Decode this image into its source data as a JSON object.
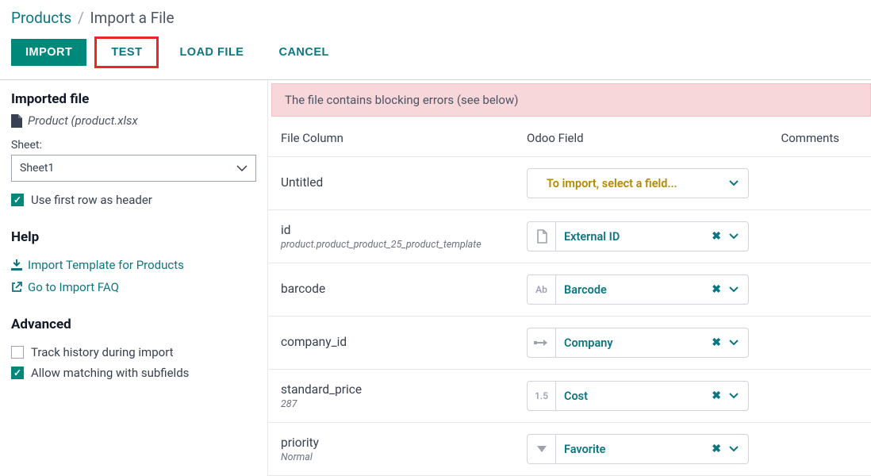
{
  "breadcrumb": {
    "parent": "Products",
    "current": "Import a File"
  },
  "toolbar": {
    "import": "IMPORT",
    "test": "TEST",
    "load_file": "LOAD FILE",
    "cancel": "CANCEL"
  },
  "sidebar": {
    "imported_heading": "Imported file",
    "file_name": "Product (product.xlsx",
    "sheet_label": "Sheet:",
    "sheet_value": "Sheet1",
    "first_row_header": "Use first row as header",
    "help_heading": "Help",
    "import_template_link": "Import Template for Products",
    "faq_link": "Go to Import FAQ",
    "advanced_heading": "Advanced",
    "track_history": "Track history during import",
    "allow_subfields": "Allow matching with subfields"
  },
  "alert": {
    "text": "The file contains blocking errors (see below)"
  },
  "columns": {
    "file": "File Column",
    "odoo": "Odoo Field",
    "comments": "Comments"
  },
  "rows": [
    {
      "name": "Untitled",
      "sample": "",
      "field_label": "To import, select a field...",
      "placeholder": true,
      "clearable": false,
      "icon": ""
    },
    {
      "name": "id",
      "sample": "product.product_product_25_product_template",
      "field_label": "External ID",
      "placeholder": false,
      "clearable": true,
      "icon": "file"
    },
    {
      "name": "barcode",
      "sample": "",
      "field_label": "Barcode",
      "placeholder": false,
      "clearable": true,
      "icon": "Ab"
    },
    {
      "name": "company_id",
      "sample": "",
      "field_label": "Company",
      "placeholder": false,
      "clearable": true,
      "icon": "arrow"
    },
    {
      "name": "standard_price",
      "sample": "287",
      "field_label": "Cost",
      "placeholder": false,
      "clearable": true,
      "icon": "1.5"
    },
    {
      "name": "priority",
      "sample": "Normal",
      "field_label": "Favorite",
      "placeholder": false,
      "clearable": true,
      "icon": "triangle"
    }
  ]
}
